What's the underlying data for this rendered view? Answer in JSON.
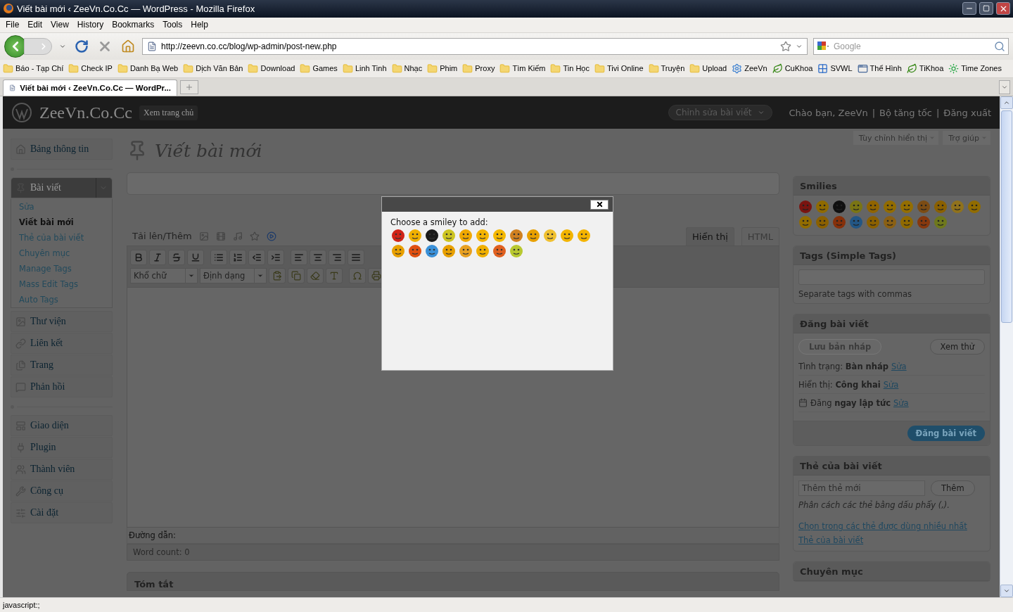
{
  "window": {
    "title": "Viết bài mới ‹ ZeeVn.Co.Cc — WordPress - Mozilla Firefox"
  },
  "menu_bar": [
    "File",
    "Edit",
    "View",
    "History",
    "Bookmarks",
    "Tools",
    "Help"
  ],
  "navigation": {
    "url": "http://zeevn.co.cc/blog/wp-admin/post-new.php",
    "search_placeholder": "Google"
  },
  "bookmarks": [
    {
      "label": "Báo - Tạp Chí",
      "kind": "folder"
    },
    {
      "label": "Check IP",
      "kind": "folder"
    },
    {
      "label": "Danh Bạ Web",
      "kind": "folder"
    },
    {
      "label": "Dịch Văn Bản",
      "kind": "folder"
    },
    {
      "label": "Download",
      "kind": "folder"
    },
    {
      "label": "Games",
      "kind": "folder"
    },
    {
      "label": "Linh Tinh",
      "kind": "folder"
    },
    {
      "label": "Nhạc",
      "kind": "folder"
    },
    {
      "label": "Phim",
      "kind": "folder"
    },
    {
      "label": "Proxy",
      "kind": "folder"
    },
    {
      "label": "Tìm Kiếm",
      "kind": "folder"
    },
    {
      "label": "Tin Học",
      "kind": "folder"
    },
    {
      "label": "Tivi Online",
      "kind": "folder"
    },
    {
      "label": "Truyện",
      "kind": "folder"
    },
    {
      "label": "Upload",
      "kind": "folder"
    },
    {
      "label": "ZeeVn",
      "kind": "gear"
    },
    {
      "label": "CuKhoa",
      "kind": "leaf"
    },
    {
      "label": "SVWL",
      "kind": "tile"
    },
    {
      "label": "Thể Hình",
      "kind": "window"
    },
    {
      "label": "TiKhoa",
      "kind": "leaf"
    },
    {
      "label": "Time Zones",
      "kind": "sun"
    }
  ],
  "tabs": [
    {
      "label": "Viết bài mới ‹ ZeeVn.Co.Cc — WordPr...",
      "selected": true
    }
  ],
  "wp_header": {
    "site_title": "ZeeVn.Co.Cc",
    "view_site": "Xem trang chủ",
    "favorite_action": "Chỉnh sửa bài viết",
    "user_links": [
      "Chào bạn, ZeeVn",
      "Bộ tăng tốc",
      "Đăng xuất"
    ],
    "separator": "|"
  },
  "screen_options": [
    "Tùy chỉnh hiển thị",
    "Trợ giúp"
  ],
  "admin_menu": {
    "groups": [
      {
        "items": [
          {
            "label": "Bảng thông tin",
            "expanded": false
          }
        ]
      },
      {
        "items": [
          {
            "label": "Bài viết",
            "expanded": true,
            "children": [
              {
                "label": "Sửa",
                "selected": false
              },
              {
                "label": "Viết bài mới",
                "selected": true
              },
              {
                "label": "Thẻ của bài viết",
                "selected": false
              },
              {
                "label": "Chuyên mục",
                "selected": false
              },
              {
                "label": "Manage Tags",
                "selected": false
              },
              {
                "label": "Mass Edit Tags",
                "selected": false
              },
              {
                "label": "Auto Tags",
                "selected": false
              }
            ]
          },
          {
            "label": "Thư viện",
            "expanded": false
          },
          {
            "label": "Liên kết",
            "expanded": false
          },
          {
            "label": "Trang",
            "expanded": false
          },
          {
            "label": "Phản hồi",
            "expanded": false
          }
        ]
      },
      {
        "items": [
          {
            "label": "Giao diện",
            "expanded": false
          },
          {
            "label": "Plugin",
            "expanded": false
          },
          {
            "label": "Thành viên",
            "expanded": false
          },
          {
            "label": "Công cụ",
            "expanded": false
          },
          {
            "label": "Cài đặt",
            "expanded": false
          }
        ]
      }
    ]
  },
  "editor": {
    "heading": "Viết bài mới",
    "upload_label": "Tải lên/Thêm",
    "mode_tabs": [
      {
        "label": "Hiển thị",
        "selected": true
      },
      {
        "label": "HTML",
        "selected": false
      }
    ],
    "format_selects": [
      "Khổ chữ",
      "Định dạng"
    ],
    "path_label": "Đường dẫn:",
    "word_count": "Word count: 0"
  },
  "excerpt": {
    "title": "Tóm tắt"
  },
  "smilies_box": {
    "title": "Smilies",
    "smilies": [
      {
        "color": "#7a1410"
      },
      {
        "color": "#8f6a00"
      },
      {
        "color": "#101010"
      },
      {
        "color": "#7a7514"
      },
      {
        "color": "#906400"
      },
      {
        "color": "#926c00"
      },
      {
        "color": "#946e00"
      },
      {
        "color": "#7c4c14"
      },
      {
        "color": "#8a6000"
      },
      {
        "color": "#90721c"
      },
      {
        "color": "#916c00"
      },
      {
        "color": "#926c00"
      },
      {
        "color": "#8a6000"
      },
      {
        "color": "#86300a"
      },
      {
        "color": "#235684"
      },
      {
        "color": "#8a6000"
      },
      {
        "color": "#8a6014"
      },
      {
        "color": "#906a00"
      },
      {
        "color": "#86380e"
      },
      {
        "color": "#6e781c"
      }
    ]
  },
  "tags_box": {
    "title": "Tags (Simple Tags)",
    "hint": "Separate tags with commas"
  },
  "publish_box": {
    "title": "Đăng bài viết",
    "save_draft": {
      "label": "Lưu bản nháp",
      "disabled": true
    },
    "preview": "Xem thử",
    "rows": [
      {
        "kind": "plain",
        "text": "Tình trạng: **Bàn nháp**",
        "link": "Sửa"
      },
      {
        "kind": "plain",
        "text": "Hiển thị: **Công khai**",
        "link": "Sửa"
      },
      {
        "kind": "calendar",
        "text": "Đăng **ngay lập tức**",
        "link": "Sửa"
      }
    ],
    "publish_button": "Đăng bài viết"
  },
  "post_tags_box": {
    "title": "Thẻ của bài viết",
    "placeholder": "Thêm thẻ mới",
    "add_button": "Thêm",
    "hint": "Phân cách các thẻ bằng dấu phẩy (,).",
    "links": [
      "Chọn trong các thẻ được dùng nhiều nhất",
      "Thẻ của bài viết"
    ]
  },
  "categories_box": {
    "title": "Chuyên mục"
  },
  "smiley_dialog": {
    "prompt": "Choose a smiley to add:",
    "smilies": [
      {
        "color": "#d02418"
      },
      {
        "color": "#f0b000"
      },
      {
        "color": "#1a1a1a"
      },
      {
        "color": "#ccc422"
      },
      {
        "color": "#f0a800"
      },
      {
        "color": "#f4b400"
      },
      {
        "color": "#f4b800"
      },
      {
        "color": "#d08020"
      },
      {
        "color": "#e8a000"
      },
      {
        "color": "#f0c030"
      },
      {
        "color": "#f2b400"
      },
      {
        "color": "#f4b400"
      },
      {
        "color": "#e8a000"
      },
      {
        "color": "#e05010"
      },
      {
        "color": "#3a90d8"
      },
      {
        "color": "#e8a000"
      },
      {
        "color": "#e8a020"
      },
      {
        "color": "#f0b000"
      },
      {
        "color": "#e06020"
      },
      {
        "color": "#b8c830"
      }
    ]
  },
  "status_bar": {
    "text": "javascript:;"
  }
}
